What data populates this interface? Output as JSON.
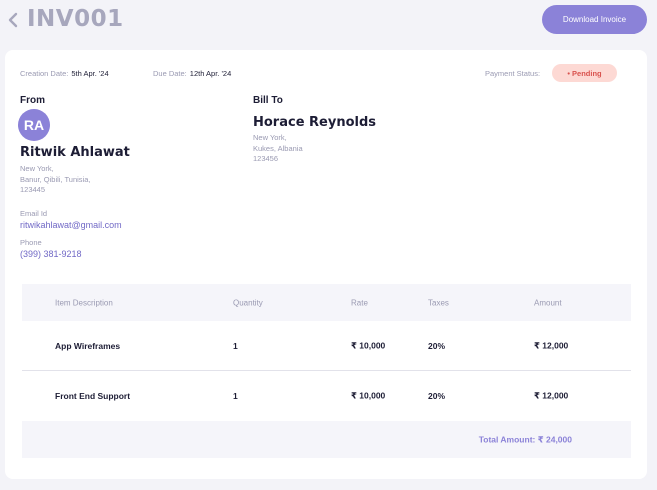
{
  "header": {
    "invoice_id": "INV001",
    "download_label": "Download Invoice"
  },
  "meta": {
    "creation_label": "Creation Date:",
    "creation_value": "5th Apr. '24",
    "due_label": "Due Date:",
    "due_value": "12th Apr. '24",
    "status_label": "Payment Status:",
    "status_value": "• Pending"
  },
  "from": {
    "heading": "From",
    "initials": "RA",
    "name": "Ritwik Ahlawat",
    "address_line1": "New York,",
    "address_line2": "Banur, Qibili, Tunisia,",
    "address_line3": "123445",
    "email_label": "Email Id",
    "email_value": "ritwikahlawat@gmail.com",
    "phone_label": "Phone",
    "phone_value": "(399) 381-9218"
  },
  "bill_to": {
    "heading": "Bill To",
    "name": "Horace Reynolds",
    "address_line1": "New York,",
    "address_line2": "Kukes, Albania",
    "address_line3": "123456"
  },
  "table": {
    "columns": [
      "Item Description",
      "Quantity",
      "Rate",
      "Taxes",
      "Amount"
    ],
    "rows": [
      [
        "App Wireframes",
        "1",
        "₹ 10,000",
        "20%",
        "₹ 12,000"
      ],
      [
        "Front End Support",
        "1",
        "₹ 10,000",
        "20%",
        "₹ 12,000"
      ]
    ],
    "total_label": "Total Amount: ₹ 24,000"
  },
  "colors": {
    "accent": "#8b82d8",
    "pending_bg": "#fdd9d4",
    "pending_text": "#d9534f",
    "muted_text": "#9a9ab2",
    "page_bg": "#f3f3f8"
  },
  "icons": {
    "back": "chevron-left-icon"
  }
}
